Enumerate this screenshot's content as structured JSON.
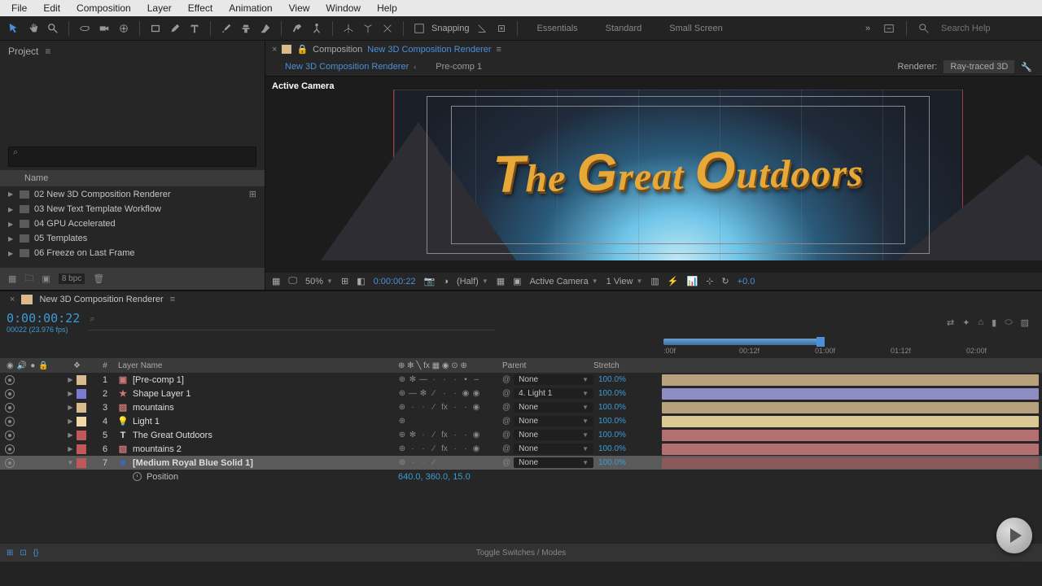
{
  "menubar": [
    "File",
    "Edit",
    "Composition",
    "Layer",
    "Effect",
    "Animation",
    "View",
    "Window",
    "Help"
  ],
  "toolbar": {
    "snapping": "Snapping",
    "workspaces": [
      "Essentials",
      "Standard",
      "Small Screen"
    ],
    "search_placeholder": "Search Help"
  },
  "project": {
    "title": "Project",
    "name_col": "Name",
    "items": [
      "02 New 3D Composition Renderer",
      "03 New Text Template Workflow",
      "04 GPU Accelerated",
      "05 Templates",
      "06 Freeze on Last Frame"
    ],
    "bpc": "8 bpc"
  },
  "comp": {
    "label": "Composition",
    "name": "New 3D Composition Renderer",
    "tabs": [
      {
        "label": "New 3D Composition Renderer",
        "active": true
      },
      {
        "label": "Pre-comp 1",
        "active": false
      }
    ],
    "renderer_label": "Renderer:",
    "renderer_value": "Ray-traced 3D",
    "active_camera": "Active Camera",
    "title_text": "The Great Outdoors"
  },
  "vbottom": {
    "zoom": "50%",
    "timecode": "0:00:00:22",
    "res": "(Half)",
    "camera": "Active Camera",
    "views": "1 View",
    "offset": "+0.0"
  },
  "timeline": {
    "comp_name": "New 3D Composition Renderer",
    "timecode": "0:00:00:22",
    "fps": "00022 (23.976 fps)",
    "ticks": [
      ":00f",
      "00:12f",
      "01:00f",
      "01:12f",
      "02:00f"
    ],
    "cols": {
      "num": "#",
      "layer": "Layer Name",
      "parent": "Parent",
      "stretch": "Stretch"
    },
    "layers": [
      {
        "n": 1,
        "color": "#d9bb8d",
        "icon": "precomp",
        "name": "[Pre-comp 1]",
        "sw": "⊕ ✻ — · · · ▪ –",
        "parent": "None",
        "stretch": "100.0%",
        "bar": "#b8a27d",
        "sel": false
      },
      {
        "n": 2,
        "color": "#7a7ad0",
        "icon": "star",
        "name": "Shape Layer 1",
        "sw": "⊕ — ✻ ∕ · · ◉ ◉",
        "parent": "4. Light 1",
        "stretch": "100.0%",
        "bar": "#8d8dc4",
        "sel": false
      },
      {
        "n": 3,
        "color": "#d9bb8d",
        "icon": "img",
        "name": "mountains",
        "sw": "⊕ · · ∕ fx · · ◉",
        "parent": "None",
        "stretch": "100.0%",
        "bar": "#b8a27d",
        "sel": false
      },
      {
        "n": 4,
        "color": "#f0d8a8",
        "icon": "light",
        "name": "Light 1",
        "sw": "⊕",
        "parent": "None",
        "stretch": "100.0%",
        "bar": "#dcc892",
        "sel": false
      },
      {
        "n": 5,
        "color": "#c05858",
        "icon": "text",
        "name": "The Great Outdoors",
        "sw": "⊕ ✻ · ∕ fx · · ◉",
        "parent": "None",
        "stretch": "100.0%",
        "bar": "#b47070",
        "sel": false
      },
      {
        "n": 6,
        "color": "#c05858",
        "icon": "img",
        "name": "mountains 2",
        "sw": "⊕ · · ∕ fx · · ◉",
        "parent": "None",
        "stretch": "100.0%",
        "bar": "#b47070",
        "sel": false
      },
      {
        "n": 7,
        "color": "#c05858",
        "icon": "solid",
        "name": "[Medium Royal Blue Solid 1]",
        "sw": "⊕ · · ∕",
        "parent": "None",
        "stretch": "100.0%",
        "bar": "#8a5a5a",
        "sel": true
      }
    ],
    "prop": {
      "label": "Position",
      "value": "640.0, 360.0, 15.0"
    },
    "toggle": "Toggle Switches / Modes"
  }
}
